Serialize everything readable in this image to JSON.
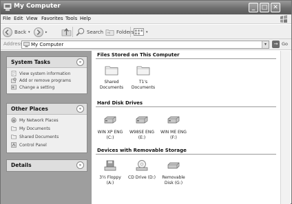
{
  "window": {
    "title": "My Computer"
  },
  "titlebar": {
    "min_glyph": "_",
    "max_glyph": "□",
    "close_glyph": "✕"
  },
  "menu": {
    "items": [
      "File",
      "Edit",
      "View",
      "Favorites",
      "Tools",
      "Help"
    ]
  },
  "toolbar": {
    "back_label": "Back",
    "forward_arrow": "▸",
    "search_label": "Search",
    "folders_label": "Folders"
  },
  "address": {
    "label": "Address",
    "value": "My Computer",
    "go_label": "Go",
    "dropdown_glyph": "▾",
    "go_glyph": "→"
  },
  "left": {
    "system_tasks": {
      "title": "System Tasks",
      "toggle": "«",
      "items": [
        "View system information",
        "Add or remove programs",
        "Change a setting"
      ]
    },
    "other_places": {
      "title": "Other Places",
      "toggle": "«",
      "items": [
        "My Network Places",
        "My Documents",
        "Shared Documents",
        "Control Panel"
      ]
    },
    "details": {
      "title": "Details",
      "toggle": "»"
    }
  },
  "main": {
    "files_section": {
      "title": "Files Stored on This Computer",
      "items": [
        {
          "line1": "Shared",
          "line2": "Documents"
        },
        {
          "line1": "T1's",
          "line2": "Documents"
        }
      ]
    },
    "disks_section": {
      "title": "Hard Disk Drives",
      "items": [
        {
          "line1": "WIN XP ENG",
          "line2": "(C:)"
        },
        {
          "line1": "W98SE ENG",
          "line2": "(E:)"
        },
        {
          "line1": "WIN ME ENG",
          "line2": "(F:)"
        }
      ]
    },
    "removable_section": {
      "title": "Devices with Removable Storage",
      "items": [
        {
          "line1": "3½ Floppy",
          "line2": "(A:)"
        },
        {
          "line1": "CD Drive (D:)",
          "line2": ""
        },
        {
          "line1": "Removable",
          "line2": "Disk (G:)"
        }
      ]
    }
  },
  "icons": {
    "app": "computer-icon",
    "back": "back-arrow-icon",
    "forward": "forward-arrow-icon",
    "up": "up-folder-icon",
    "search": "search-icon",
    "folders": "folders-icon",
    "views": "views-icon",
    "folder": "folder-icon",
    "drive": "hard-drive-icon",
    "floppy": "floppy-icon",
    "cd": "cd-drive-icon",
    "removable": "removable-disk-icon"
  }
}
